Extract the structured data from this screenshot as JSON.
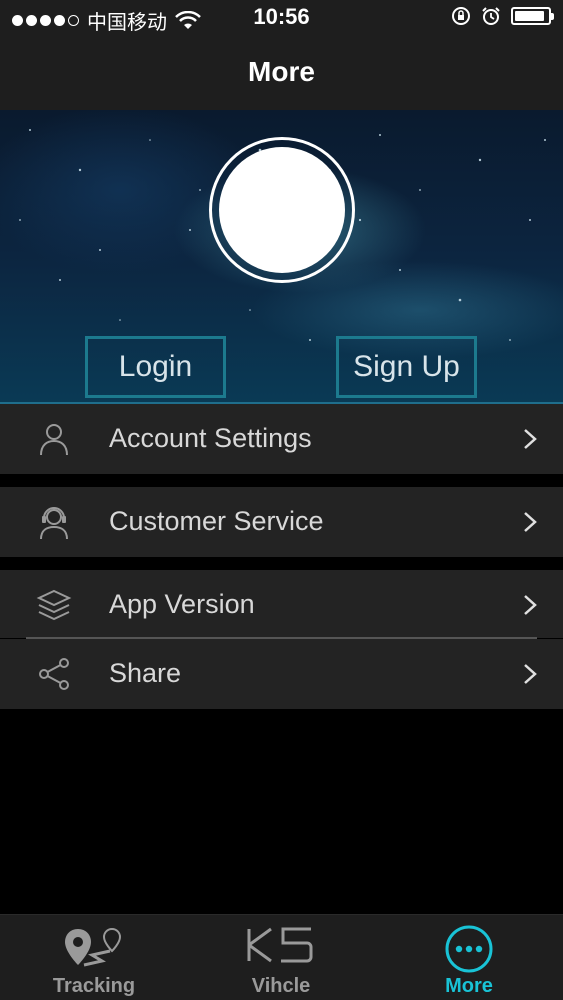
{
  "status_bar": {
    "carrier": "中国移动",
    "time": "10:56",
    "battery_level": 0.9
  },
  "nav": {
    "title": "More"
  },
  "hero": {
    "login_label": "Login",
    "signup_label": "Sign Up"
  },
  "menu": {
    "items": [
      {
        "label": "Account Settings",
        "icon": "user-icon"
      },
      {
        "label": "Customer Service",
        "icon": "headset-icon"
      },
      {
        "label": "App Version",
        "icon": "layers-icon"
      },
      {
        "label": "Share",
        "icon": "share-icon"
      }
    ]
  },
  "tabs": {
    "items": [
      {
        "label": "Tracking",
        "icon": "route-pin-icon",
        "active": false
      },
      {
        "label": "Vihcle",
        "icon": "k5-logo-icon",
        "active": false
      },
      {
        "label": "More",
        "icon": "more-dots-icon",
        "active": true
      }
    ]
  },
  "colors": {
    "accent": "#19c3d6",
    "hero_button_border": "#1c7a8e",
    "background": "#000000",
    "row_background": "#232323"
  }
}
